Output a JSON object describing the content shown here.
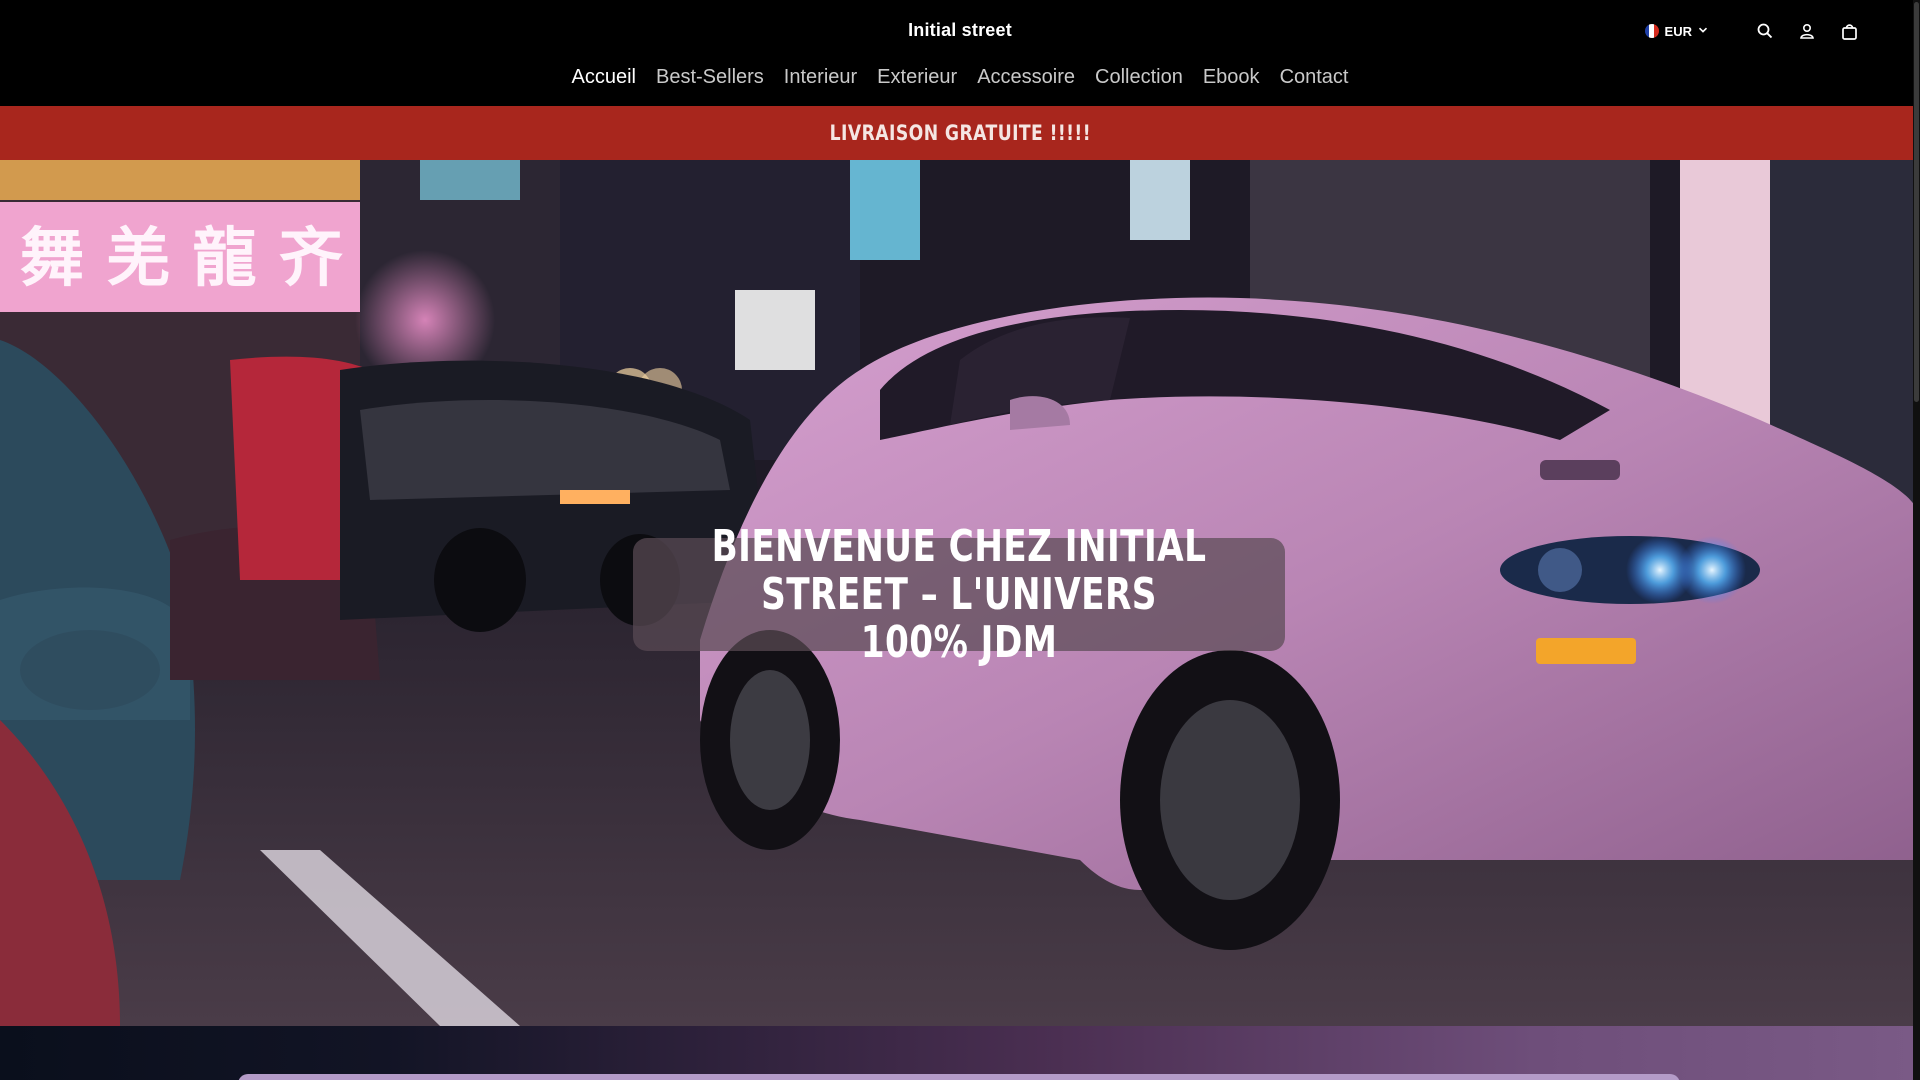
{
  "header": {
    "brand": "Initial street",
    "currency": {
      "code": "EUR",
      "flag_colors": [
        "#1f3fa6",
        "#ffffff",
        "#d52b1e"
      ]
    },
    "icons": [
      "chevron-down-icon",
      "search-icon",
      "account-icon",
      "cart-icon"
    ]
  },
  "nav": {
    "items": [
      {
        "label": "Accueil",
        "active": true
      },
      {
        "label": "Best-Sellers"
      },
      {
        "label": "Interieur"
      },
      {
        "label": "Exterieur"
      },
      {
        "label": "Accessoire"
      },
      {
        "label": "Collection"
      },
      {
        "label": "Ebook"
      },
      {
        "label": "Contact"
      }
    ]
  },
  "announcement": {
    "text": "LIVRAISON GRATUITE !!!!!",
    "color": "#a8261d"
  },
  "hero": {
    "title": "BIENVENUE CHEZ INITIAL STREET – L'UNIVERS 100% JDM",
    "image": "night-street-jdm-cars",
    "accent_color": "#c48fc0"
  }
}
